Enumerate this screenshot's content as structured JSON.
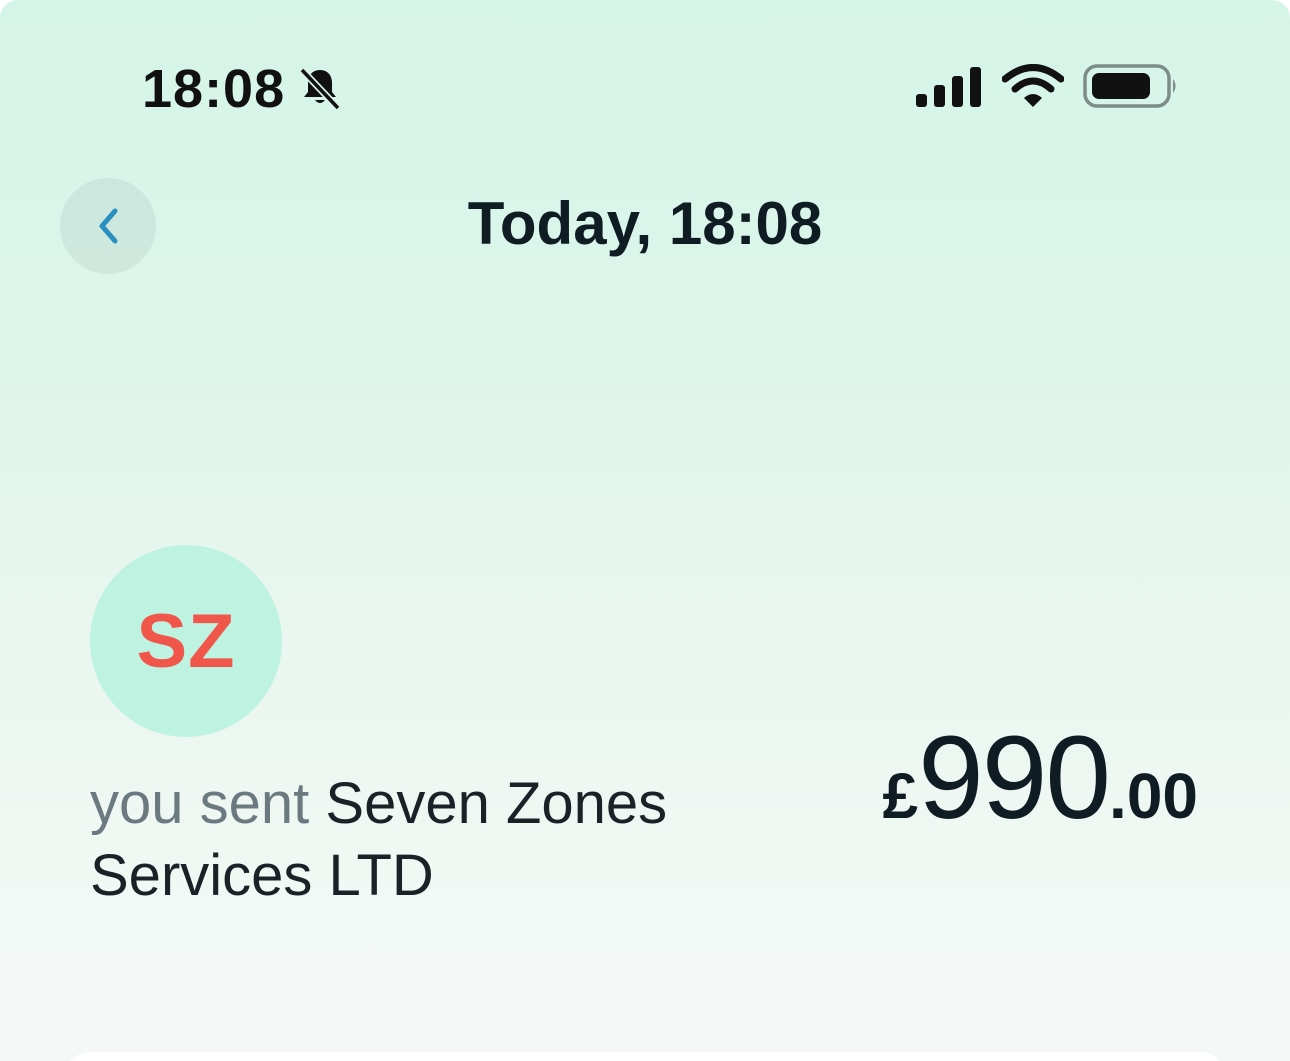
{
  "status_bar": {
    "time": "18:08",
    "icons": [
      "bell-muted-icon",
      "cellular-signal-icon",
      "wifi-icon",
      "battery-icon"
    ]
  },
  "header": {
    "back_icon": "chevron-left-icon",
    "title": "Today, 18:08"
  },
  "transaction": {
    "avatar_initials": "SZ",
    "description_prefix": "you sent",
    "recipient": "Seven Zones Services LTD",
    "amount": {
      "currency": "£",
      "major": "990",
      "minor": ".00"
    }
  },
  "colors": {
    "accent": "#2a8fbf",
    "avatar_bg": "#bff3e1",
    "avatar_text": "#f0574a",
    "text_primary": "#0f1c24",
    "text_muted": "#6b7a80"
  }
}
